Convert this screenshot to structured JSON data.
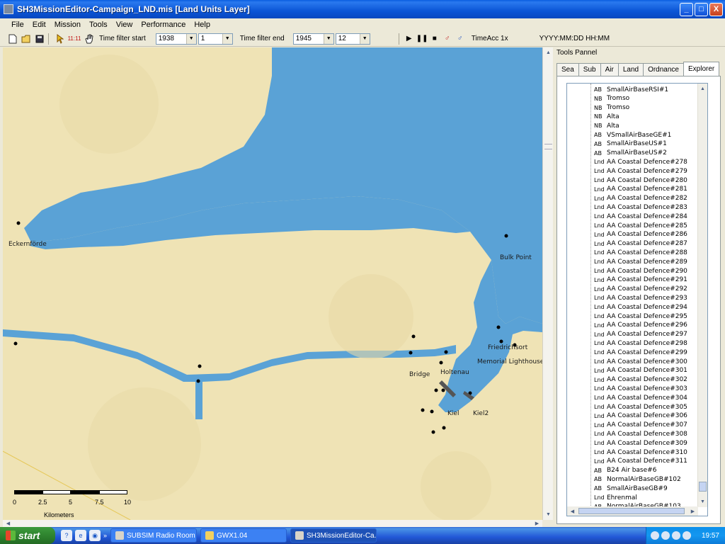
{
  "window": {
    "title": "SH3MissionEditor-Campaign_LND.mis [Land Units Layer]",
    "min_label": "_",
    "max_label": "□",
    "close_label": "X"
  },
  "menu": [
    "File",
    "Edit",
    "Mission",
    "Tools",
    "View",
    "Performance",
    "Help"
  ],
  "toolbar": {
    "filter_start_label": "Time filter start",
    "filter_start_year": "1938",
    "filter_start_month": "1",
    "filter_end_label": "Time filter end",
    "filter_end_year": "1945",
    "filter_end_month": "12",
    "clock_icon_text": "11:11",
    "timeacc_label": "TimeAcc 1x",
    "datetime_format": "YYYY:MM:DD HH:MM"
  },
  "map": {
    "places": {
      "eckernforde": "Eckernförde",
      "bulk_point": "Bulk Point",
      "friedrichsort": "Friedrichsort",
      "memorial_lighthouse": "Memorial Lighthouse",
      "bridge": "Bridge",
      "holtenau": "Holtenau",
      "kiel": "Kiel",
      "kiel2": "Kiel2"
    },
    "scale": {
      "ticks": [
        "0",
        "2.5",
        "5",
        "7.5",
        "10"
      ],
      "unit": "Kilometers"
    },
    "colors": {
      "land": "#efe3b5",
      "water": "#5aa2d6"
    }
  },
  "panel": {
    "title": "Tools Pannel",
    "tabs": [
      "Sea",
      "Sub",
      "Air",
      "Land",
      "Ordnance",
      "Explorer"
    ],
    "active_tab": "Explorer",
    "items": [
      {
        "type": "AB",
        "name": "SmallAirBaseRSI#1"
      },
      {
        "type": "NB",
        "name": "Tromso"
      },
      {
        "type": "NB",
        "name": "Tromso"
      },
      {
        "type": "NB",
        "name": "Alta"
      },
      {
        "type": "NB",
        "name": "Alta"
      },
      {
        "type": "AB",
        "name": "VSmallAirBaseGE#1"
      },
      {
        "type": "AB",
        "name": "SmallAirBaseUS#1"
      },
      {
        "type": "AB",
        "name": "SmallAirBaseUS#2"
      },
      {
        "type": "Lnd",
        "name": "AA Coastal Defence#278"
      },
      {
        "type": "Lnd",
        "name": "AA Coastal Defence#279"
      },
      {
        "type": "Lnd",
        "name": "AA Coastal Defence#280"
      },
      {
        "type": "Lnd",
        "name": "AA Coastal Defence#281"
      },
      {
        "type": "Lnd",
        "name": "AA Coastal Defence#282"
      },
      {
        "type": "Lnd",
        "name": "AA Coastal Defence#283"
      },
      {
        "type": "Lnd",
        "name": "AA Coastal Defence#284"
      },
      {
        "type": "Lnd",
        "name": "AA Coastal Defence#285"
      },
      {
        "type": "Lnd",
        "name": "AA Coastal Defence#286"
      },
      {
        "type": "Lnd",
        "name": "AA Coastal Defence#287"
      },
      {
        "type": "Lnd",
        "name": "AA Coastal Defence#288"
      },
      {
        "type": "Lnd",
        "name": "AA Coastal Defence#289"
      },
      {
        "type": "Lnd",
        "name": "AA Coastal Defence#290"
      },
      {
        "type": "Lnd",
        "name": "AA Coastal Defence#291"
      },
      {
        "type": "Lnd",
        "name": "AA Coastal Defence#292"
      },
      {
        "type": "Lnd",
        "name": "AA Coastal Defence#293"
      },
      {
        "type": "Lnd",
        "name": "AA Coastal Defence#294"
      },
      {
        "type": "Lnd",
        "name": "AA Coastal Defence#295"
      },
      {
        "type": "Lnd",
        "name": "AA Coastal Defence#296"
      },
      {
        "type": "Lnd",
        "name": "AA Coastal Defence#297"
      },
      {
        "type": "Lnd",
        "name": "AA Coastal Defence#298"
      },
      {
        "type": "Lnd",
        "name": "AA Coastal Defence#299"
      },
      {
        "type": "Lnd",
        "name": "AA Coastal Defence#300"
      },
      {
        "type": "Lnd",
        "name": "AA Coastal Defence#301"
      },
      {
        "type": "Lnd",
        "name": "AA Coastal Defence#302"
      },
      {
        "type": "Lnd",
        "name": "AA Coastal Defence#303"
      },
      {
        "type": "Lnd",
        "name": "AA Coastal Defence#304"
      },
      {
        "type": "Lnd",
        "name": "AA Coastal Defence#305"
      },
      {
        "type": "Lnd",
        "name": "AA Coastal Defence#306"
      },
      {
        "type": "Lnd",
        "name": "AA Coastal Defence#307"
      },
      {
        "type": "Lnd",
        "name": "AA Coastal Defence#308"
      },
      {
        "type": "Lnd",
        "name": "AA Coastal Defence#309"
      },
      {
        "type": "Lnd",
        "name": "AA Coastal Defence#310"
      },
      {
        "type": "Lnd",
        "name": "AA Coastal Defence#311"
      },
      {
        "type": "AB",
        "name": "B24 Air base#6"
      },
      {
        "type": "AB",
        "name": "NormalAirBaseGB#102"
      },
      {
        "type": "AB",
        "name": "SmallAirBaseGB#9"
      },
      {
        "type": "Lnd",
        "name": "Ehrenmal"
      },
      {
        "type": "AB",
        "name": "NormalAirBaseGB#103"
      }
    ]
  },
  "taskbar": {
    "start_label": "start",
    "tasks": [
      {
        "label": "SUBSIM Radio Room ..."
      },
      {
        "label": "GWX1.04"
      },
      {
        "label": "SH3MissionEditor-Ca..."
      }
    ],
    "clock": "19:57"
  }
}
